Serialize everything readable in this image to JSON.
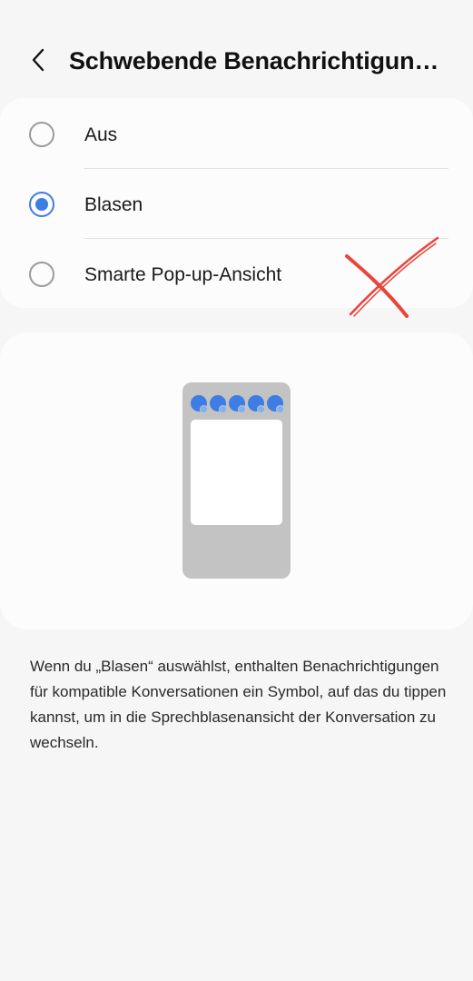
{
  "header": {
    "title": "Schwebende Benachrichtigungen",
    "back_icon": "chevron-left-icon"
  },
  "options": {
    "items": [
      {
        "label": "Aus",
        "selected": false
      },
      {
        "label": "Blasen",
        "selected": true
      },
      {
        "label": "Smarte Pop-up-Ansicht",
        "selected": false
      }
    ]
  },
  "annotation": {
    "icon": "red-cross-mark-icon",
    "color": "#e8453c"
  },
  "preview": {
    "illustration": "phone-bubbles-illustration",
    "bubble_count": 5,
    "accent_color": "#3e7de3"
  },
  "description": {
    "text": "Wenn du „Blasen“ auswählst, enthalten Benachrichtigungen für kompatible Konversationen ein Symbol, auf das du tippen kannst, um in die Sprechblasenansicht der Konversation zu wechseln."
  }
}
